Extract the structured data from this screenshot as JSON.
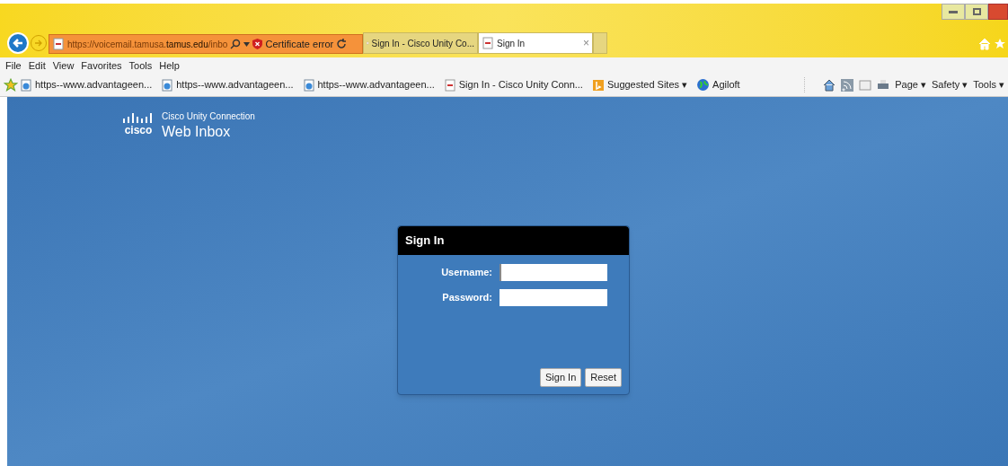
{
  "address_bar": {
    "url_prefix": "https://voicemail.tamusa.",
    "url_domain": "tamus.edu",
    "url_suffix": "/inbo",
    "certificate_error": "Certificate error"
  },
  "tabs": [
    {
      "label": "Sign In - Cisco Unity Co...",
      "selected": false
    },
    {
      "label": "Sign In",
      "selected": true,
      "close": "×"
    }
  ],
  "menu_bar": [
    "File",
    "Edit",
    "View",
    "Favorites",
    "Tools",
    "Help"
  ],
  "favorites_bar": [
    {
      "kind": "ie",
      "label": "https--www.advantageen..."
    },
    {
      "kind": "ie",
      "label": "https--www.advantageen..."
    },
    {
      "kind": "ie",
      "label": "https--www.advantageen..."
    },
    {
      "kind": "cisco",
      "label": "Sign In - Cisco Unity Conn..."
    },
    {
      "kind": "bing",
      "label": "Suggested Sites ▾"
    },
    {
      "kind": "globe",
      "label": "Agiloft"
    }
  ],
  "command_bar": [
    "Page ▾",
    "Safety ▾",
    "Tools ▾"
  ],
  "header": {
    "logo": "cisco",
    "product": "Cisco Unity Connection",
    "title": "Web Inbox"
  },
  "sign_in": {
    "title": "Sign In",
    "fields": [
      {
        "label": "Username:",
        "focused": true
      },
      {
        "label": "Password:",
        "focused": false
      }
    ],
    "buttons": [
      "Sign In",
      "Reset"
    ]
  }
}
